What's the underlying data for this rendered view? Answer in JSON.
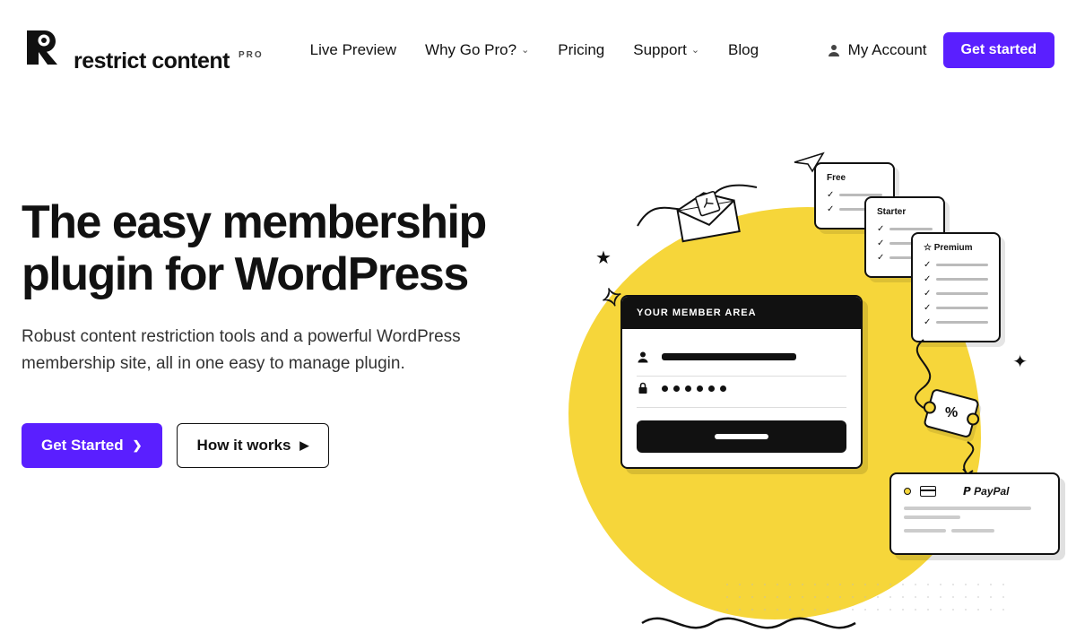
{
  "brand": {
    "name": "restrict content",
    "suffix": "PRO"
  },
  "nav": {
    "live_preview": "Live Preview",
    "why_go_pro": "Why Go Pro?",
    "pricing": "Pricing",
    "support": "Support",
    "blog": "Blog"
  },
  "account": {
    "label": "My Account",
    "cta": "Get started"
  },
  "hero": {
    "title": "The easy membership plugin for WordPress",
    "subtitle": "Robust content restriction tools and a powerful WordPress membership site, all in one easy to manage plugin.",
    "primary_cta": "Get Started",
    "secondary_cta": "How it works"
  },
  "illus": {
    "member_header": "YOUR MEMBER AREA",
    "tiers": {
      "free": "Free",
      "starter": "Starter",
      "premium": "Premium"
    },
    "paypal": "PayPal",
    "coupon": "%"
  }
}
